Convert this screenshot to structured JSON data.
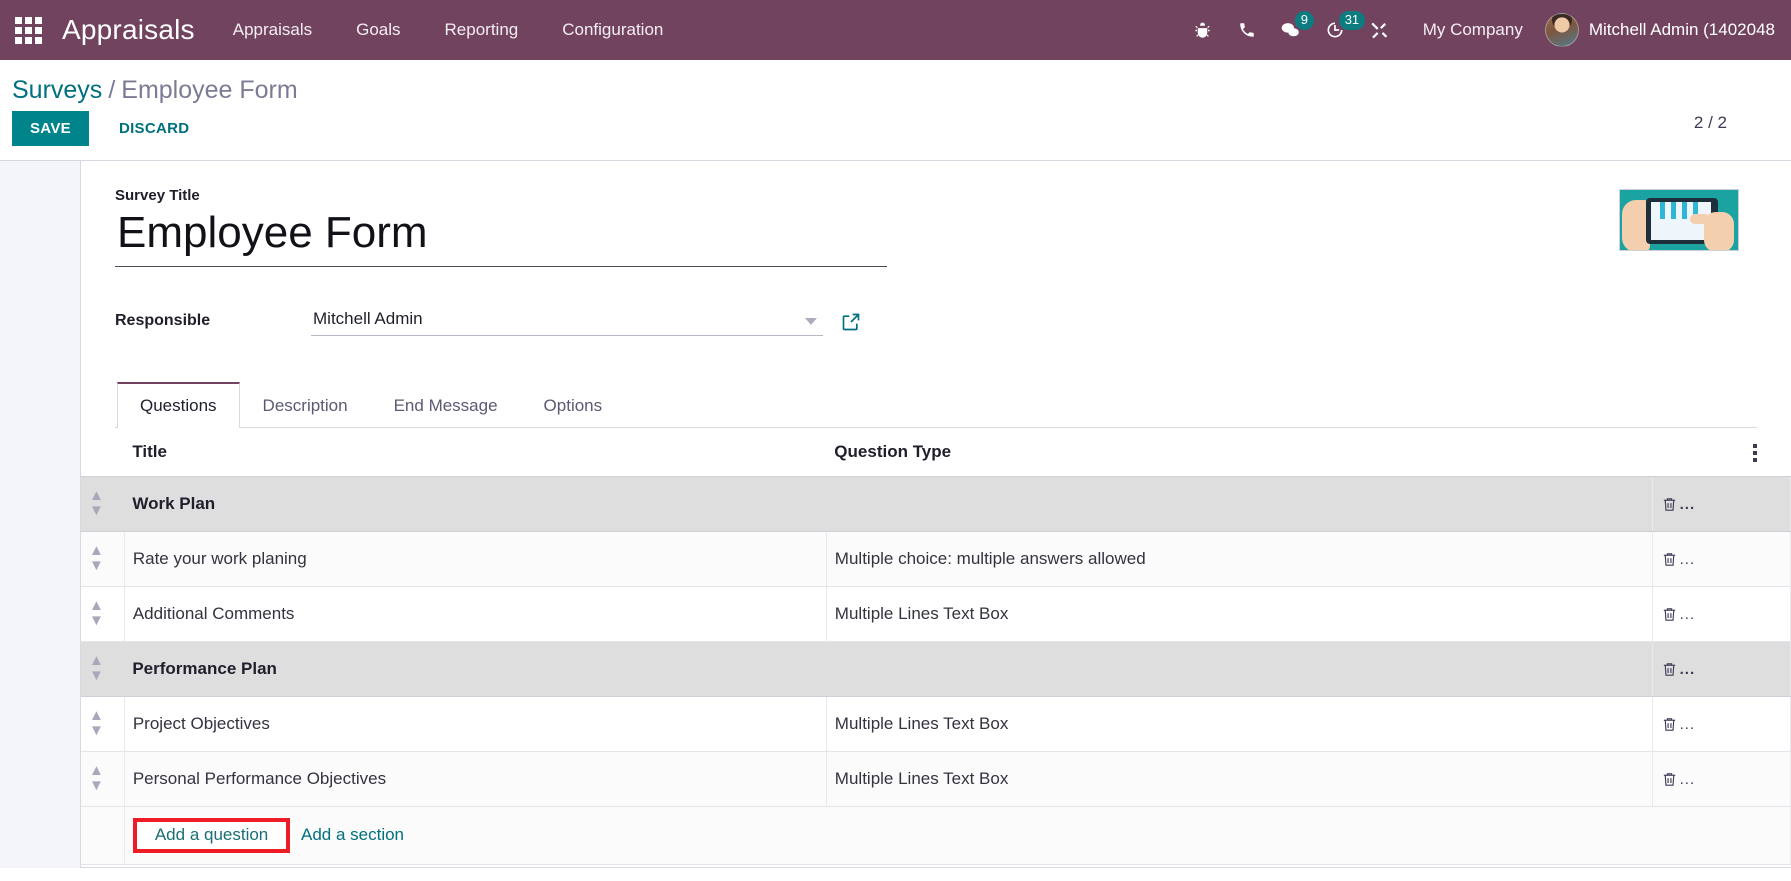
{
  "navbar": {
    "apps_icon": "apps-grid-icon",
    "brand": "Appraisals",
    "menu": [
      {
        "label": "Appraisals"
      },
      {
        "label": "Goals"
      },
      {
        "label": "Reporting"
      },
      {
        "label": "Configuration"
      }
    ],
    "sys_icons": [
      {
        "name": "bug-icon",
        "badge": ""
      },
      {
        "name": "phone-icon",
        "badge": ""
      },
      {
        "name": "messages-icon",
        "badge": "9"
      },
      {
        "name": "activities-clock-icon",
        "badge": "31"
      },
      {
        "name": "tools-icon",
        "badge": ""
      }
    ],
    "company": "My Company",
    "user": "Mitchell Admin (1402048",
    "background_color": "#71435f",
    "badge_color": "#0d7c80"
  },
  "control_panel": {
    "breadcrumb_root": "Surveys",
    "breadcrumb_sep": "/",
    "breadcrumb_current": "Employee Form",
    "save_label": "SAVE",
    "discard_label": "DISCARD",
    "pager": "2 / 2",
    "save_color": "#00848c"
  },
  "form": {
    "title_label": "Survey Title",
    "title_value": "Employee Form",
    "responsible_label": "Responsible",
    "responsible_value": "Mitchell Admin",
    "thumbnail_alt": "survey-tablet-illustration"
  },
  "notebook": {
    "tabs": [
      {
        "label": "Questions",
        "active": true
      },
      {
        "label": "Description",
        "active": false
      },
      {
        "label": "End Message",
        "active": false
      },
      {
        "label": "Options",
        "active": false
      }
    ]
  },
  "list": {
    "columns": {
      "title": "Title",
      "question_type": "Question Type"
    },
    "rows": [
      {
        "kind": "section",
        "title": "Work Plan",
        "question_type": ""
      },
      {
        "kind": "question",
        "title": "Rate your work planing",
        "question_type": "Multiple choice: multiple answers allowed"
      },
      {
        "kind": "question",
        "title": "Additional Comments",
        "question_type": "Multiple Lines Text Box"
      },
      {
        "kind": "section",
        "title": "Performance Plan",
        "question_type": ""
      },
      {
        "kind": "question",
        "title": "Project Objectives",
        "question_type": "Multiple Lines Text Box"
      },
      {
        "kind": "question",
        "title": "Personal Performance Objectives",
        "question_type": "Multiple Lines Text Box"
      }
    ],
    "row_trash_suffix": "...",
    "add_question_label": "Add a question",
    "add_section_label": "Add a section",
    "highlight_color": "#ee1c25",
    "highlighted_element": "add-a-question-link"
  }
}
